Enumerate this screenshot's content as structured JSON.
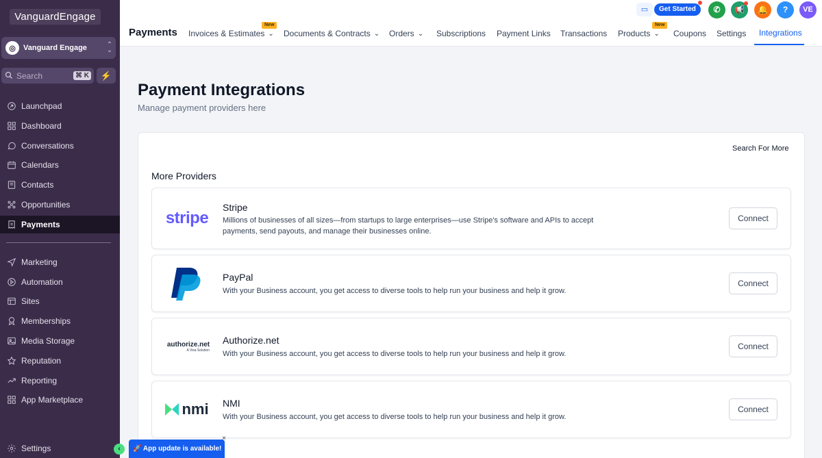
{
  "brand": {
    "logo_text": "VanguardEngage"
  },
  "account": {
    "name": "Vanguard Engage"
  },
  "search": {
    "placeholder": "Search",
    "shortcut": "⌘ K"
  },
  "sidebar": {
    "items": [
      {
        "label": "Launchpad",
        "icon": "rocket-icon"
      },
      {
        "label": "Dashboard",
        "icon": "grid-icon"
      },
      {
        "label": "Conversations",
        "icon": "chat-icon"
      },
      {
        "label": "Calendars",
        "icon": "calendar-icon"
      },
      {
        "label": "Contacts",
        "icon": "contacts-icon"
      },
      {
        "label": "Opportunities",
        "icon": "pipeline-icon"
      },
      {
        "label": "Payments",
        "icon": "receipt-icon",
        "active": true
      },
      {
        "label": "Marketing",
        "icon": "send-icon"
      },
      {
        "label": "Automation",
        "icon": "automation-icon"
      },
      {
        "label": "Sites",
        "icon": "sites-icon"
      },
      {
        "label": "Memberships",
        "icon": "award-icon"
      },
      {
        "label": "Media Storage",
        "icon": "image-icon"
      },
      {
        "label": "Reputation",
        "icon": "star-icon"
      },
      {
        "label": "Reporting",
        "icon": "trend-icon"
      },
      {
        "label": "App Marketplace",
        "icon": "apps-icon"
      },
      {
        "label": "Settings",
        "icon": "gear-icon"
      }
    ]
  },
  "header": {
    "title": "Payments",
    "new_badge": "New",
    "tabs": [
      {
        "label": "Invoices & Estimates",
        "chevron": true
      },
      {
        "label": "Documents & Contracts",
        "chevron": true
      },
      {
        "label": "Orders",
        "chevron": true
      },
      {
        "label": "Subscriptions"
      },
      {
        "label": "Payment Links"
      },
      {
        "label": "Transactions"
      },
      {
        "label": "Products",
        "chevron": true
      },
      {
        "label": "Coupons"
      },
      {
        "label": "Settings"
      },
      {
        "label": "Integrations",
        "active": true
      }
    ],
    "get_started": "Get Started",
    "help": "?",
    "avatar_initials": "VE"
  },
  "main": {
    "title": "Payment Integrations",
    "subtitle": "Manage payment providers here",
    "search_more": "Search For More",
    "section_heading": "More Providers",
    "providers": [
      {
        "name": "Stripe",
        "logo_text": "stripe",
        "description": "Millions of businesses of all sizes—from startups to large enterprises—use Stripe's software and APIs to accept payments, send payouts, and manage their businesses online.",
        "button": "Connect"
      },
      {
        "name": "PayPal",
        "logo_text": "",
        "description": "With your Business account, you get access to diverse tools to help run your business and help it grow.",
        "button": "Connect"
      },
      {
        "name": "Authorize.net",
        "logo_text": "authorize.net",
        "logo_sub": "A Visa Solution",
        "description": "With your Business account, you get access to diverse tools to help run your business and help it grow.",
        "button": "Connect"
      },
      {
        "name": "NMI",
        "logo_text": "nmi",
        "description": "With your Business account, you get access to diverse tools to help run your business and help it grow.",
        "button": "Connect"
      }
    ]
  },
  "toast": {
    "text": "🚀 App update is available!",
    "close": "×"
  },
  "colors": {
    "sidebar_bg": "#3b2d4a",
    "accent": "#155eef",
    "stripe": "#635bff",
    "paypal_dark": "#003087",
    "paypal_light": "#009cde",
    "nmi_green": "#4ade80"
  }
}
